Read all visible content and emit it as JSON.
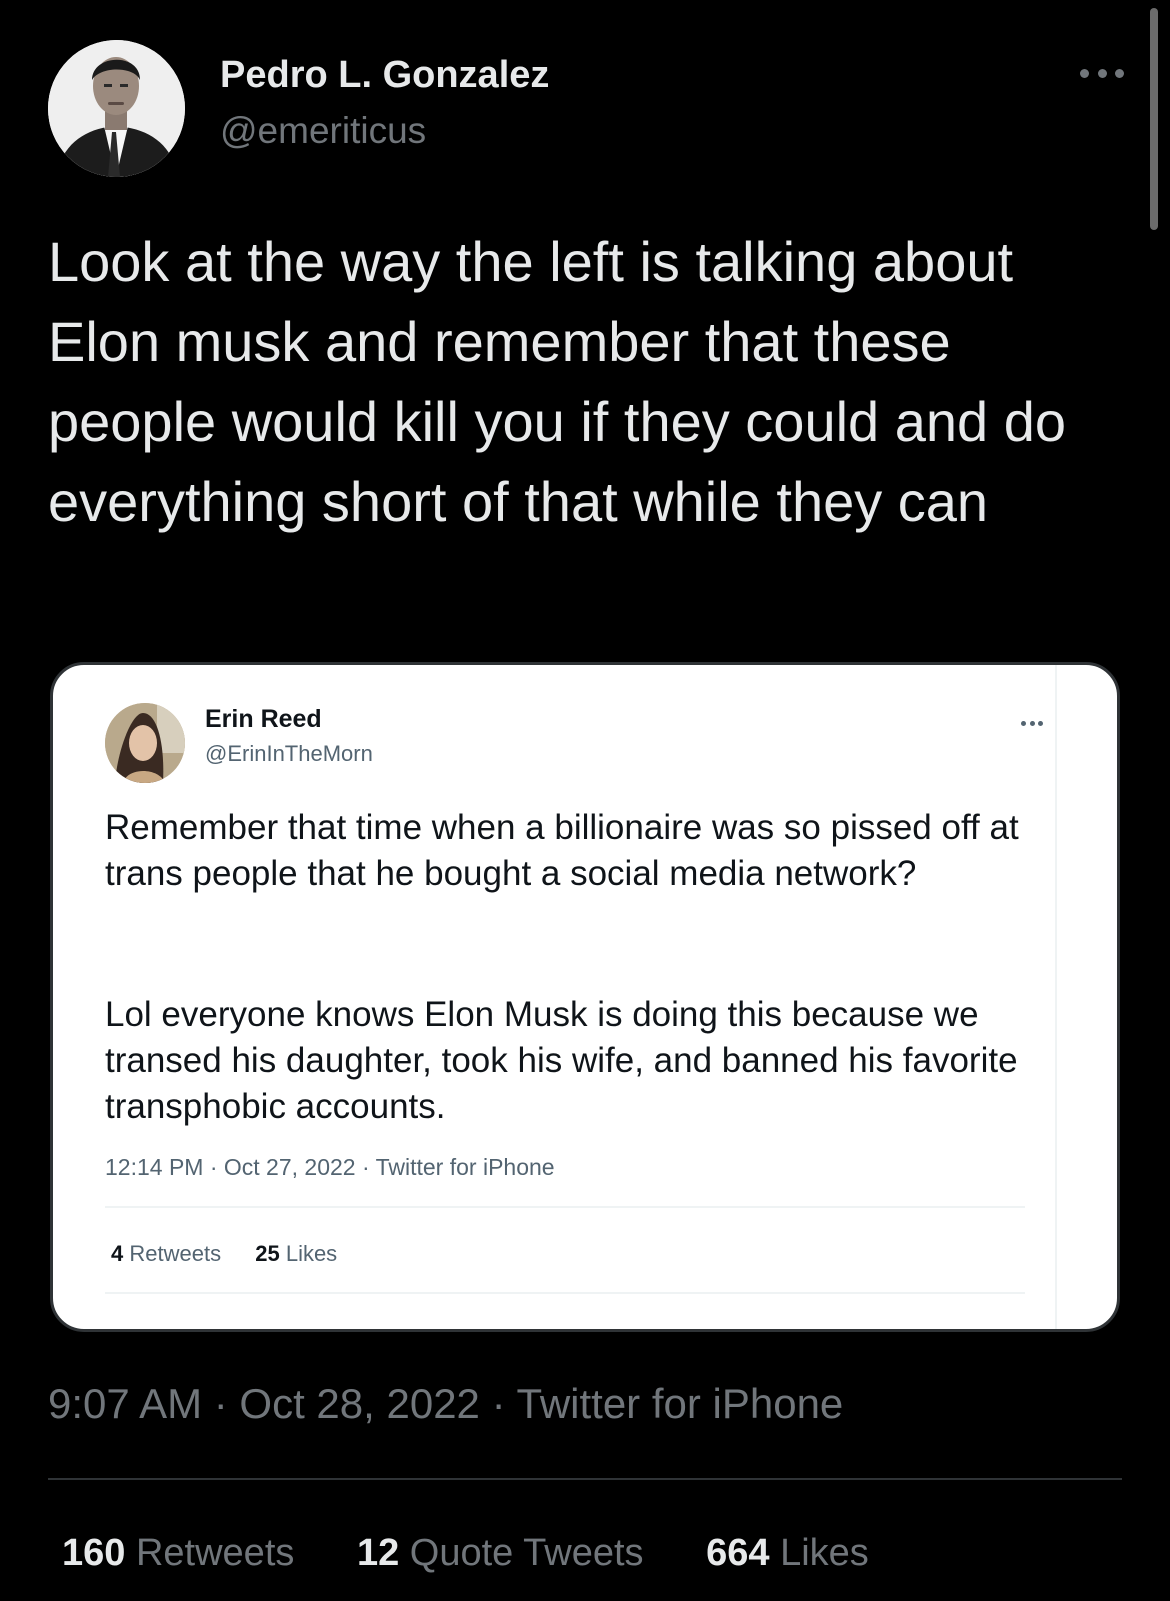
{
  "tweet": {
    "author_name": "Pedro L. Gonzalez",
    "author_handle": "@emeriticus",
    "text": "Look at the way the left is talking about Elon musk and remember that these people would kill you if they could and do everything short of that while they can",
    "timestamp": "9:07 AM · Oct 28, 2022 · Twitter for iPhone",
    "more_icon": "more-horizontal-icon",
    "stats": {
      "retweets_count": "160",
      "retweets_label": "Retweets",
      "quotes_count": "12",
      "quotes_label": "Quote Tweets",
      "likes_count": "664",
      "likes_label": "Likes"
    }
  },
  "quoted_tweet": {
    "author_name": "Erin Reed",
    "author_handle": "@ErinInTheMorn",
    "paragraph_1": "Remember that time when a billionaire was so pissed off at trans people that he bought a social media network?",
    "paragraph_2": "Lol everyone knows Elon Musk is doing this because we transed his daughter, took his wife, and banned his favorite transphobic accounts.",
    "timestamp": "12:14 PM · Oct 27, 2022 · Twitter for iPhone",
    "stats": {
      "retweets_count": "4",
      "retweets_label": "Retweets",
      "likes_count": "25",
      "likes_label": "Likes"
    }
  },
  "colors": {
    "background": "#000000",
    "primary_text": "#e7e9ea",
    "secondary_text": "#71767b",
    "card_background": "#ffffff",
    "card_text": "#0f1419",
    "card_secondary": "#536471"
  }
}
